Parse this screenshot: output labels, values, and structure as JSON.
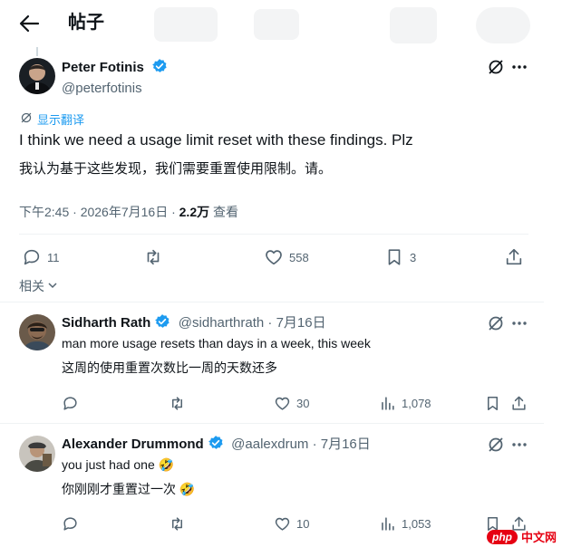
{
  "header": {
    "title": "帖子"
  },
  "main_post": {
    "name": "Peter Fotinis",
    "handle": "@peterfotinis",
    "translate_label": "显示翻译",
    "text": "I think we need a usage limit reset with these findings. Plz",
    "translation": "我认为基于这些发现，我们需要重置使用限制。请。",
    "time": "下午2:45 · 2026年7月16日 · ",
    "views": "2.2万",
    "views_label": " 查看",
    "replies": "11",
    "likes": "558",
    "bookmarks": "3"
  },
  "related_label": "相关",
  "replies": [
    {
      "name": "Sidharth Rath",
      "handle": "@sidharthrath · 7月16日",
      "text": "man more usage resets than days in a week, this week",
      "translation": "这周的使用重置次数比一周的天数还多",
      "likes": "30",
      "views": "1,078"
    },
    {
      "name": "Alexander Drummond",
      "handle": "@aalexdrum · 7月16日",
      "text": "you just had one 🤣",
      "translation": "你刚刚才重置过一次 🤣",
      "likes": "10",
      "views": "1,053"
    }
  ],
  "watermark": {
    "logo": "php",
    "text": "中文网"
  },
  "colors": {
    "accent": "#1d9bf0",
    "muted": "#536471",
    "text": "#0f1419"
  }
}
